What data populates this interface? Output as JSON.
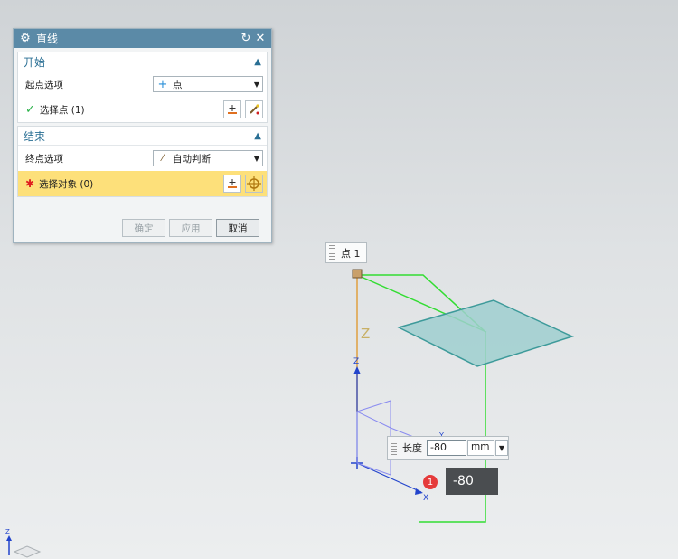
{
  "dialog": {
    "title": "直线",
    "start": {
      "header": "开始",
      "option_label": "起点选项",
      "option_value": "点",
      "select_label": "选择点 (1)"
    },
    "end": {
      "header": "结束",
      "option_label": "终点选项",
      "option_value": "自动判断",
      "select_label": "选择对象 (0)"
    },
    "buttons": {
      "ok": "确定",
      "apply": "应用",
      "cancel": "取消"
    }
  },
  "viewport": {
    "point_tag": "点 1",
    "length_label": "长度",
    "length_value": "-80",
    "length_unit": "mm",
    "badge_number": "1",
    "tooltip_value": "-80",
    "axis_z_big": "Z",
    "axis_z_small": "Z",
    "axis_x": "X",
    "axis_y": "Y",
    "corner_axis_z": "Z"
  },
  "colors": {
    "title_bar": "#5b8aa7",
    "active_row": "#fde07a",
    "green_line": "#33dd33",
    "plane": "#9fcfcf",
    "orange_axis": "#e0a040"
  }
}
